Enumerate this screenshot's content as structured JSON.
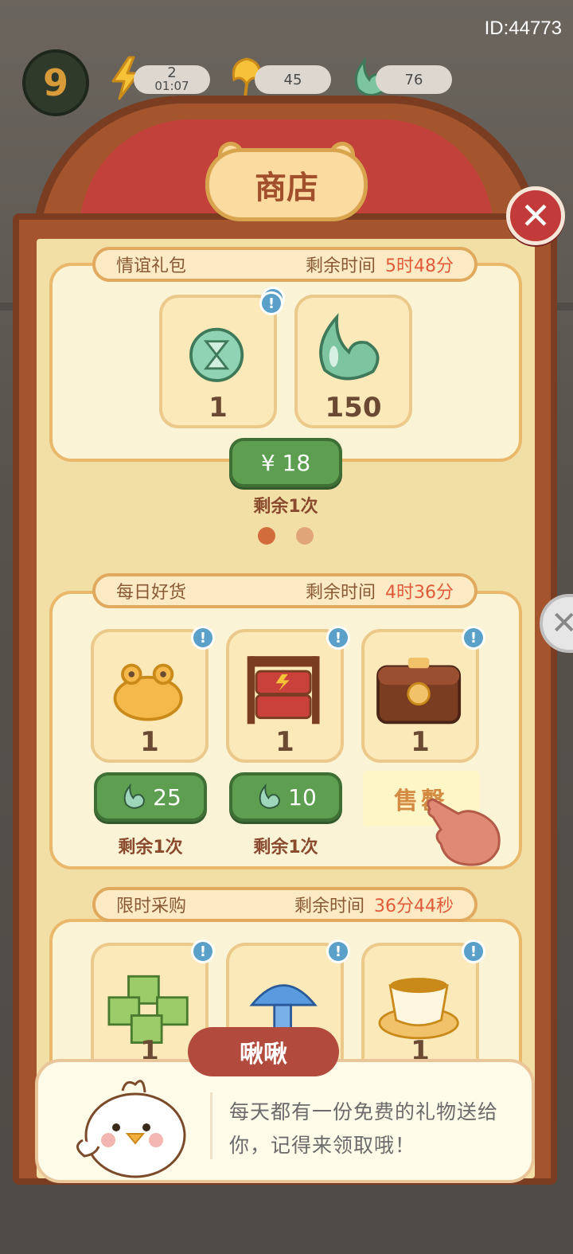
{
  "header": {
    "user_id": "ID:44773",
    "level": "9",
    "energy": {
      "count": "2",
      "timer": "01:07"
    },
    "leaf_currency": "45",
    "jade_currency": "76"
  },
  "shop": {
    "title": "商店",
    "close_icon": "close-icon"
  },
  "sections": {
    "friendship": {
      "name": "情谊礼包",
      "time_label": "剩余时间",
      "time_value": "5时48分",
      "items": [
        {
          "icon": "hourglass-coin-icon",
          "qty": "1"
        },
        {
          "icon": "jade-drop-icon",
          "qty": "150"
        }
      ],
      "price": "¥ 18",
      "remaining": "剩余1次",
      "page_indicator": {
        "pages": 2,
        "active": 0
      }
    },
    "daily": {
      "name": "每日好货",
      "time_label": "剩余时间",
      "time_value": "4时36分",
      "items": [
        {
          "icon": "golden-frog-icon",
          "qty": "1",
          "price": "25",
          "remaining": "剩余1次"
        },
        {
          "icon": "lunch-box-icon",
          "qty": "1",
          "price": "10",
          "remaining": "剩余1次"
        },
        {
          "icon": "treasure-chest-icon",
          "qty": "1",
          "sold_label": "售罄"
        }
      ]
    },
    "limited": {
      "name": "限时采购",
      "time_label": "剩余时间",
      "time_value": "36分44秒",
      "items": [
        {
          "icon": "green-cake-icon",
          "qty": "1"
        },
        {
          "icon": "blue-mushroom-icon",
          "qty": "1"
        },
        {
          "icon": "tea-cup-icon",
          "qty": "1"
        }
      ]
    }
  },
  "dialog": {
    "speaker": "啾啾",
    "message": "每天都有一份免费的礼物送给你，记得来领取哦！"
  },
  "colors": {
    "frame": "#a5552e",
    "panel": "#f2dfa6",
    "price_green": "#5e9e51",
    "time_red": "#e05a3a"
  }
}
